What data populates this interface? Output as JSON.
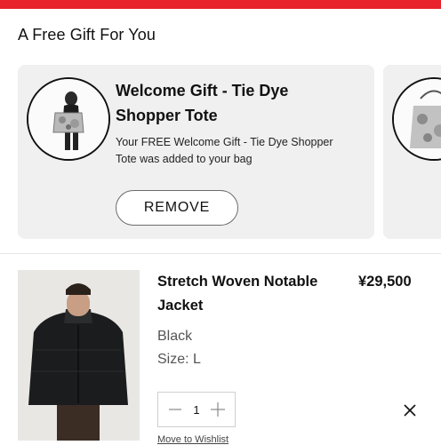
{
  "header": {
    "title": "A Free Gift For You"
  },
  "gift": {
    "title": "Welcome Gift - Tie Dye Shopper Tote",
    "description": "Your FREE Welcome Gift - Tie Dye Shopper Tote was added to your bag",
    "remove_label": "REMOVE"
  },
  "product": {
    "name": "Stretch Woven Notable Jacket",
    "price": "¥29,500",
    "color": "Black",
    "size": "Size: L",
    "quantity": "1",
    "move_to_wishlist": "Move to Wishlist"
  },
  "colors": {
    "accent": "#e8232b",
    "card_bg": "#f0f0f0"
  }
}
